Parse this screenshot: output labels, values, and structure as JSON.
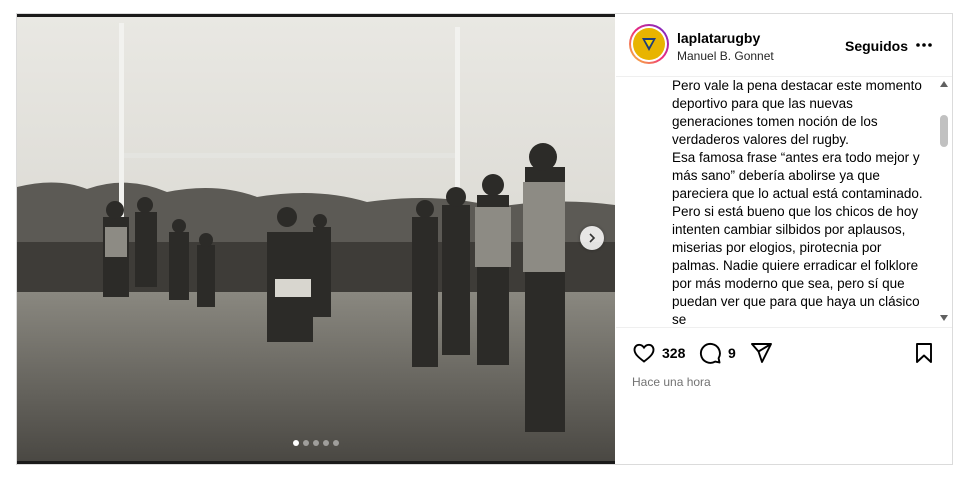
{
  "account": {
    "username": "laplatarugby",
    "location": "Manuel B. Gonnet",
    "follow_status": "Seguidos"
  },
  "caption": {
    "paragraphs": [
      "Pero vale la pena destacar este momento deportivo para que las nuevas generaciones tomen noción de los verdaderos valores del rugby.",
      "Esa famosa frase “antes era todo mejor y más sano” debería abolirse ya que pareciera que lo actual está contaminado. Pero si está bueno que los chicos de hoy intenten cambiar silbidos por aplausos, miserias por elogios, pirotecnia por palmas. Nadie quiere erradicar el folklore por más moderno que sea, pero sí que puedan ver que para que haya un clásico se"
    ]
  },
  "actions": {
    "likes": "328",
    "comments": "9"
  },
  "timestamp": "Hace una hora",
  "carousel": {
    "slide_count": 5,
    "active_index": 0
  },
  "icons": {
    "like": "heart-icon",
    "comment": "comment-icon",
    "share": "share-icon",
    "save": "bookmark-icon",
    "more": "more-options-icon",
    "next": "chevron-right-icon"
  },
  "colors": {
    "photo_tone": "#6b6b66",
    "avatar_accent": "#e8b400",
    "muted_text": "#737373"
  }
}
